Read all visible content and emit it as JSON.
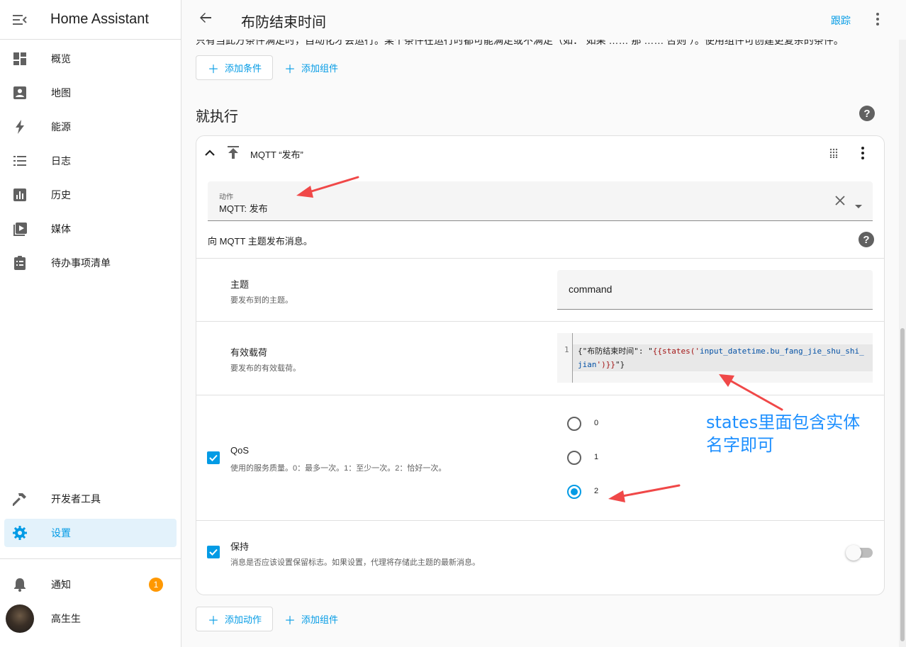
{
  "app": {
    "title": "Home Assistant"
  },
  "sidebar": {
    "items": [
      {
        "label": "概览",
        "icon": "dashboard-icon"
      },
      {
        "label": "地图",
        "icon": "map-account-icon"
      },
      {
        "label": "能源",
        "icon": "lightning-icon"
      },
      {
        "label": "日志",
        "icon": "logbook-list-icon"
      },
      {
        "label": "历史",
        "icon": "history-chart-icon"
      },
      {
        "label": "媒体",
        "icon": "media-play-icon"
      },
      {
        "label": "待办事项清单",
        "icon": "clipboard-list-icon"
      }
    ],
    "bottom_items": [
      {
        "label": "开发者工具",
        "icon": "hammer-icon"
      },
      {
        "label": "设置",
        "icon": "gear-icon",
        "active": true
      }
    ],
    "notifications": {
      "label": "通知",
      "count": "1"
    },
    "user": {
      "name": "高生生"
    }
  },
  "header": {
    "title": "布防结束时间",
    "track_label": "跟踪"
  },
  "conditions": {
    "clipped_text": "只有当此方条件满足时，自动化才会运行。某个条件在运行时都可能满足或不满足（如：“如果 …… 那 …… 否则”）。使用组件可创建更复杂的条件。",
    "add_condition": "添加条件",
    "add_building_block": "添加组件"
  },
  "actions": {
    "section_title": "就执行",
    "card_title": "MQTT “发布”",
    "action_field": {
      "label": "动作",
      "value": "MQTT: 发布"
    },
    "description": "向 MQTT 主题发布消息。",
    "topic": {
      "title": "主题",
      "subtitle": "要发布到的主题。",
      "value": "command"
    },
    "payload": {
      "title": "有效载荷",
      "subtitle": "要发布的有效载荷。",
      "line_number": "1",
      "code_part1": "{\"布防结束时间\": \"",
      "code_part2": "{{states('",
      "code_part3": "input_datetime.bu_fang_jie_shu_shi_jian",
      "code_part4": "')}}",
      "code_part5": "\"}"
    },
    "qos": {
      "title": "QoS",
      "subtitle": "使用的服务质量。0：最多一次。1：至少一次。2：恰好一次。",
      "options": [
        "0",
        "1",
        "2"
      ],
      "selected": "2"
    },
    "retain": {
      "title": "保持",
      "subtitle": "消息是否应该设置保留标志。如果设置，代理将存储此主题的最新消息。",
      "enabled": false
    },
    "add_action": "添加动作",
    "add_building_block": "添加组件"
  },
  "annotation": {
    "text": "states里面包含实体名字即可",
    "color": "#1e90ff",
    "arrow_color": "#f04848"
  },
  "colors": {
    "accent": "#039be5",
    "badge": "#ff9800"
  }
}
